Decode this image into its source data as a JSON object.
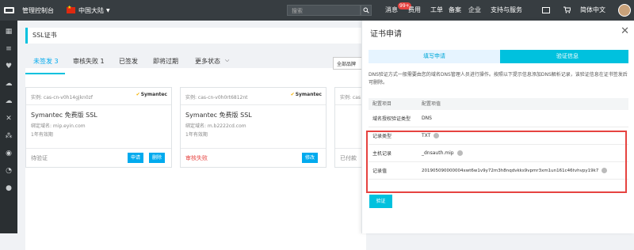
{
  "topbar": {
    "console": "管理控制台",
    "region": "中国大陆",
    "search_placeholder": "搜索",
    "nav": [
      "消息",
      "费用",
      "工单",
      "备案",
      "企业",
      "支持与服务"
    ],
    "message_badge": "99+",
    "language": "简体中文"
  },
  "sidebar_icons": [
    "grid-icon",
    "menu-icon",
    "shield-icon",
    "cloud-icon",
    "cloud-download-icon",
    "tools-icon",
    "cluster-icon",
    "globe-icon",
    "chart-icon",
    "circle-icon"
  ],
  "page": {
    "title": "SSL证书",
    "tabs": [
      {
        "label": "未签发 3",
        "active": true
      },
      {
        "label": "审核失败 1",
        "active": false
      },
      {
        "label": "已签发",
        "active": false
      },
      {
        "label": "即将过期",
        "active": false
      },
      {
        "label": "更多状态",
        "active": false
      }
    ],
    "brand_filter": "全部品牌"
  },
  "cards": [
    {
      "instance": "实例: cas-cn-v0h14gjkn0zf",
      "brand": "Symantec",
      "title": "Symantec 免费版 SSL",
      "domain": "绑定域名:  mip.eyin.com",
      "validity": "1年有效期",
      "status": "待验证",
      "status_color": "#888",
      "buttons": [
        "申请",
        "删除"
      ]
    },
    {
      "instance": "实例: cas-cn-v0h0rt6812nt",
      "brand": "Symantec",
      "title": "Symantec 免费版 SSL",
      "domain": "绑定域名:  m.b2222cd.com",
      "validity": "1年有效期",
      "status": "审核失败",
      "status_color": "#e64340",
      "buttons": [
        "修改"
      ]
    },
    {
      "instance": "实例: cas",
      "brand": "",
      "title": "",
      "domain": "",
      "validity": "",
      "status": "已付款",
      "status_color": "#888",
      "buttons": []
    }
  ],
  "drawer": {
    "title": "证书申请",
    "steps": [
      "填写申请",
      "验证信息"
    ],
    "description": "DNS验证方式一般需要由您的域名DNS管理人员进行操作。按照以下提示信息添加DNS解析记录，该验证信息在证书签发后可删除。",
    "table_header": [
      "配置项目",
      "配置项值"
    ],
    "rows": [
      {
        "key": "域名授权验证类型",
        "value": "DNS",
        "help": false
      },
      {
        "key": "记录类型",
        "value": "TXT",
        "help": true
      },
      {
        "key": "主机记录",
        "value": "_dnsauth.mip",
        "help": true
      },
      {
        "key": "记录值",
        "value": "201905090000004xwt6w1v9y72m3h8nqdvkks9vpmr3xm1un161c46tvhvpy19k7",
        "help": true
      }
    ],
    "confirm_button": "验证"
  },
  "colors": {
    "accent": "#00c1de",
    "highlight_border": "#e64340",
    "topbar": "#373d41"
  }
}
